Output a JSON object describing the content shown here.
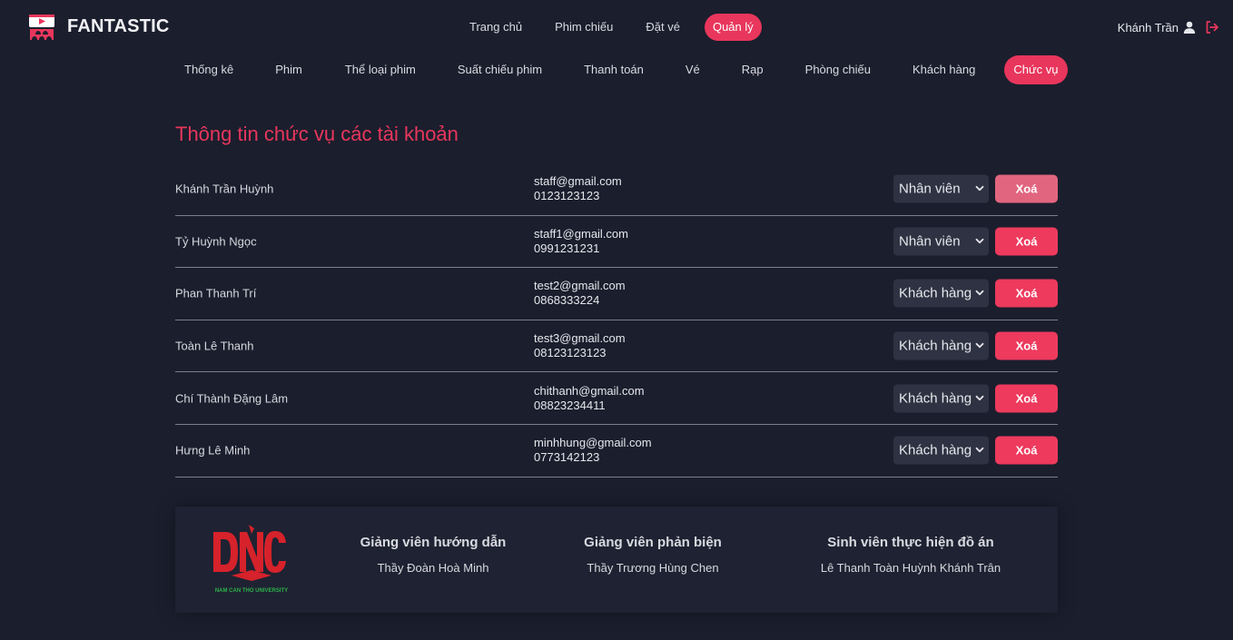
{
  "brand": {
    "name": "FANTASTIC",
    "accent": "#e8365c",
    "bg": "#1b1e2d"
  },
  "topnav": [
    {
      "label": "Trang chủ",
      "active": false
    },
    {
      "label": "Phim chiếu",
      "active": false
    },
    {
      "label": "Đặt vé",
      "active": false
    },
    {
      "label": "Quản lý",
      "active": true
    }
  ],
  "user": {
    "name": "Khánh Trần",
    "icon": "user-icon",
    "logout_icon": "logout-icon"
  },
  "subnav": [
    {
      "label": "Thống kê"
    },
    {
      "label": "Phim"
    },
    {
      "label": "Thể loại phim"
    },
    {
      "label": "Suất chiếu phim"
    },
    {
      "label": "Thanh toán"
    },
    {
      "label": "Vé"
    },
    {
      "label": "Rạp"
    },
    {
      "label": "Phòng chiếu"
    },
    {
      "label": "Khách hàng"
    },
    {
      "label": "Chức vụ",
      "active": true
    }
  ],
  "page_title": "Thông tin chức vụ các tài khoản",
  "accounts": [
    {
      "name": "Khánh Trần Huỳnh",
      "email": "staff@gmail.com",
      "phone": "0123123123",
      "role": "Nhân viên",
      "delete_label": "Xoá"
    },
    {
      "name": "Tỷ Huỳnh Ngọc",
      "email": "staff1@gmail.com",
      "phone": "0991231231",
      "role": "Nhân viên",
      "delete_label": "Xoá"
    },
    {
      "name": "Phan Thanh Trí",
      "email": "test2@gmail.com",
      "phone": "0868333224",
      "role": "Khách hàng",
      "delete_label": "Xoá"
    },
    {
      "name": "Toàn Lê Thanh",
      "email": "test3@gmail.com",
      "phone": "08123123123",
      "role": "Khách hàng",
      "delete_label": "Xoá"
    },
    {
      "name": "Chí Thành Đặng Lâm",
      "email": "chithanh@gmail.com",
      "phone": "08823234411",
      "role": "Khách hàng",
      "delete_label": "Xoá"
    },
    {
      "name": "Hưng Lê Minh",
      "email": "minhhung@gmail.com",
      "phone": "0773142123",
      "role": "Khách hàng",
      "delete_label": "Xoá"
    }
  ],
  "footer": {
    "logo": {
      "text": "DNC",
      "caption": "NAM CAN THO UNIVERSITY"
    },
    "columns": [
      {
        "heading": "Giảng viên hướng dẫn",
        "value": "Thầy Đoàn Hoà Minh"
      },
      {
        "heading": "Giảng viên phản biện",
        "value": "Thầy Trương Hùng Chen"
      },
      {
        "heading": "Sinh viên thực hiện đồ án",
        "value": "Lê Thanh Toàn Huỳnh Khánh Trân"
      }
    ]
  }
}
